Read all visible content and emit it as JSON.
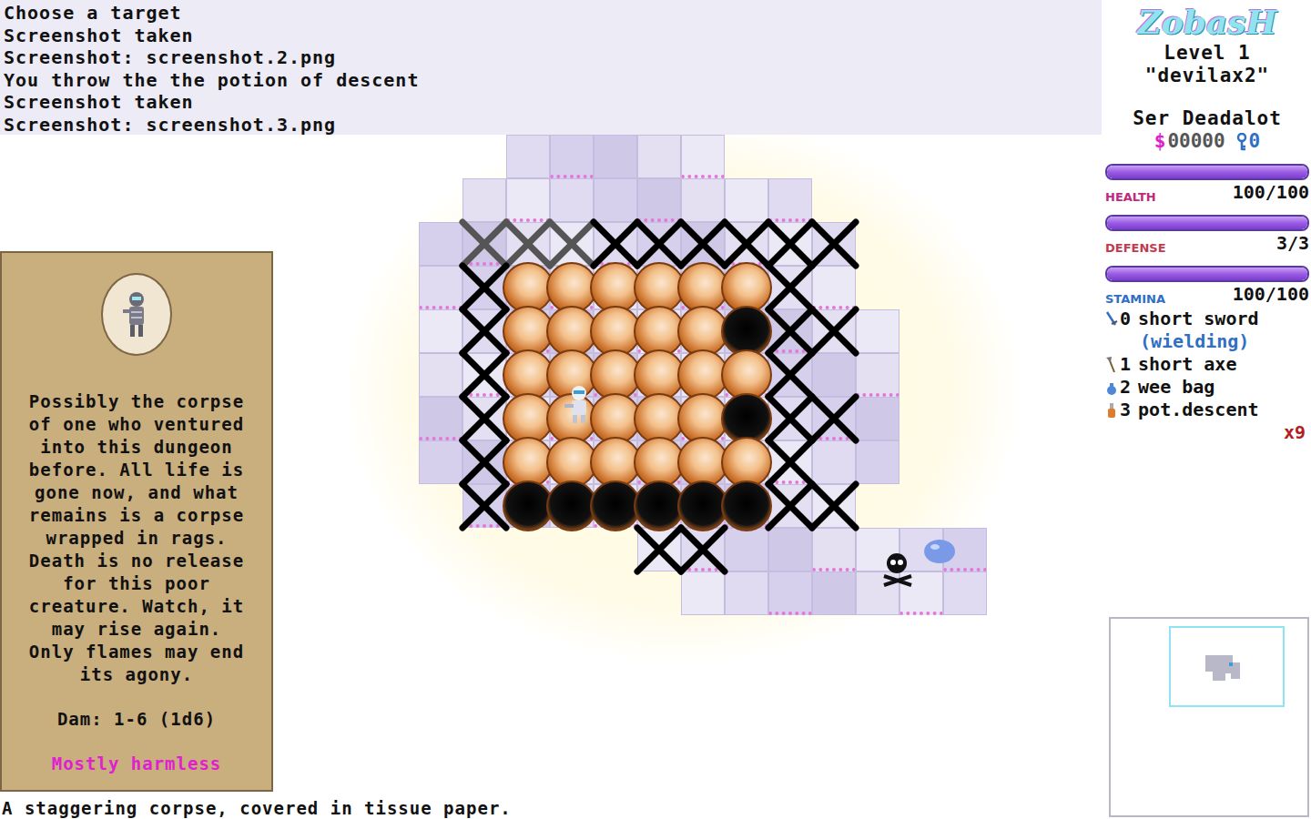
{
  "message_log": [
    "Choose a target",
    "Screenshot taken",
    "Screenshot: screenshot.2.png",
    "You throw the the potion of descent",
    "Screenshot taken",
    "Screenshot: screenshot.3.png"
  ],
  "logo": "ZobasH",
  "level": "Level 1",
  "seed": "\"devilax2\"",
  "character": "Ser Deadalot",
  "currency": "$",
  "gold": "00000",
  "keys": "0",
  "stats": [
    {
      "label": "HEALTH",
      "value": "100/100",
      "level": 1,
      "color": "#c0287e"
    },
    {
      "label": "DEFENSE",
      "value": "3/3",
      "level": 1,
      "color": "#c23a4e"
    },
    {
      "label": "STAMINA",
      "value": "100/100",
      "level": 1,
      "color": "#2f6fc4"
    }
  ],
  "inventory": [
    {
      "key": "0",
      "name": "short sword",
      "note": "(wielding)",
      "count": "",
      "kind": "sword"
    },
    {
      "key": "1",
      "name": "short axe",
      "note": "",
      "count": "",
      "kind": "axe"
    },
    {
      "key": "2",
      "name": "wee bag",
      "note": "",
      "count": "",
      "kind": "bag"
    },
    {
      "key": "3",
      "name": "pot.descent",
      "note": "",
      "count": "x9",
      "kind": "potion"
    }
  ],
  "inspect": {
    "description_lines": [
      "Possibly the corpse",
      "of one who ventured",
      "into this dungeon",
      "before. All life is",
      "gone now, and what",
      "remains is a corpse",
      "wrapped in rags.",
      "Death is no release",
      "for this poor",
      "creature. Watch, it",
      "may rise again.",
      "Only flames may end",
      "its agony."
    ],
    "damage": "Dam: 1-6 (1d6)",
    "threat": "Mostly harmless"
  },
  "status_line": "A staggering corpse, covered in tissue paper."
}
